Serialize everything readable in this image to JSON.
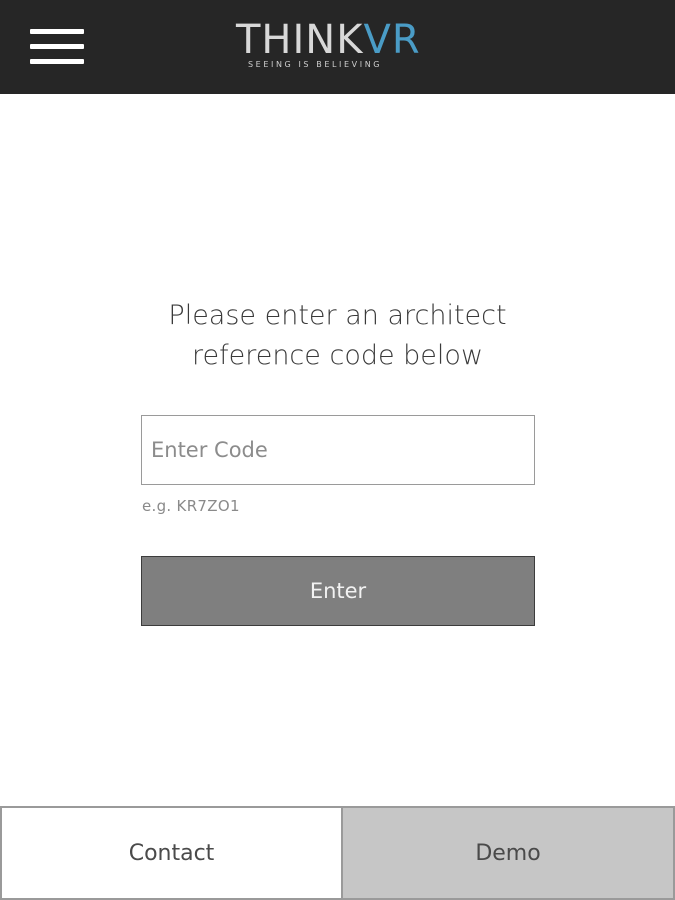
{
  "header": {
    "menu_icon": "hamburger-menu-icon",
    "logo": {
      "think": "THINK",
      "vr": "VR",
      "tagline": "SEEING IS BELIEVING"
    },
    "colors": {
      "background": "#262626",
      "logo_think": "#d8d8d8",
      "logo_vr": "#4a9cc6"
    }
  },
  "main": {
    "prompt_line1": "Please enter an architect",
    "prompt_line2": "reference code below",
    "code_input": {
      "value": "",
      "placeholder": "Enter Code"
    },
    "hint": "e.g. KR7ZO1",
    "enter_label": "Enter"
  },
  "bottom_bar": {
    "contact_label": "Contact",
    "demo_label": "Demo"
  }
}
